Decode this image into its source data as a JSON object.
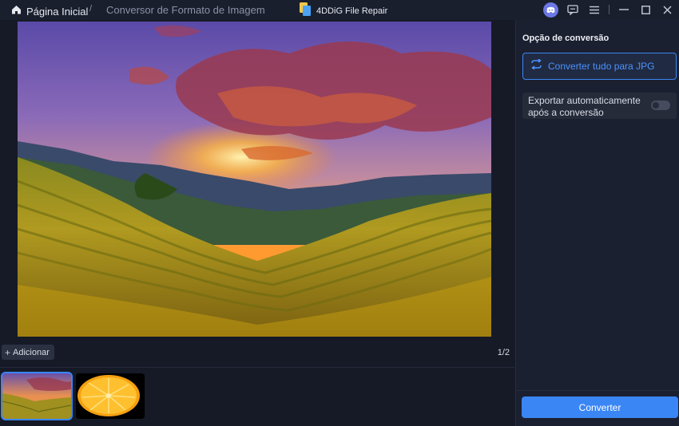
{
  "titlebar": {
    "home_label": "Página Inicial",
    "separator": "/",
    "breadcrumb": "Conversor de Formato de Imagem",
    "app_name": "4DDiG File Repair"
  },
  "preview": {
    "image": "terraced-rice-fields-sunset"
  },
  "bottom": {
    "add_label": "Adicionar",
    "add_icon": "+",
    "page_indicator": "1/2",
    "thumbnails": [
      {
        "subject": "terraced-rice-fields-sunset",
        "selected": true
      },
      {
        "subject": "orange-slice",
        "selected": false
      }
    ]
  },
  "sidebar": {
    "title": "Opção de conversão",
    "convert_all_label": "Converter tudo para JPG",
    "auto_export_label": "Exportar automaticamente após a conversão",
    "auto_export_enabled": false,
    "convert_button_label": "Converter"
  },
  "colors": {
    "accent": "#3a86f5",
    "background": "#161a27",
    "sidebar": "#1b2030"
  }
}
